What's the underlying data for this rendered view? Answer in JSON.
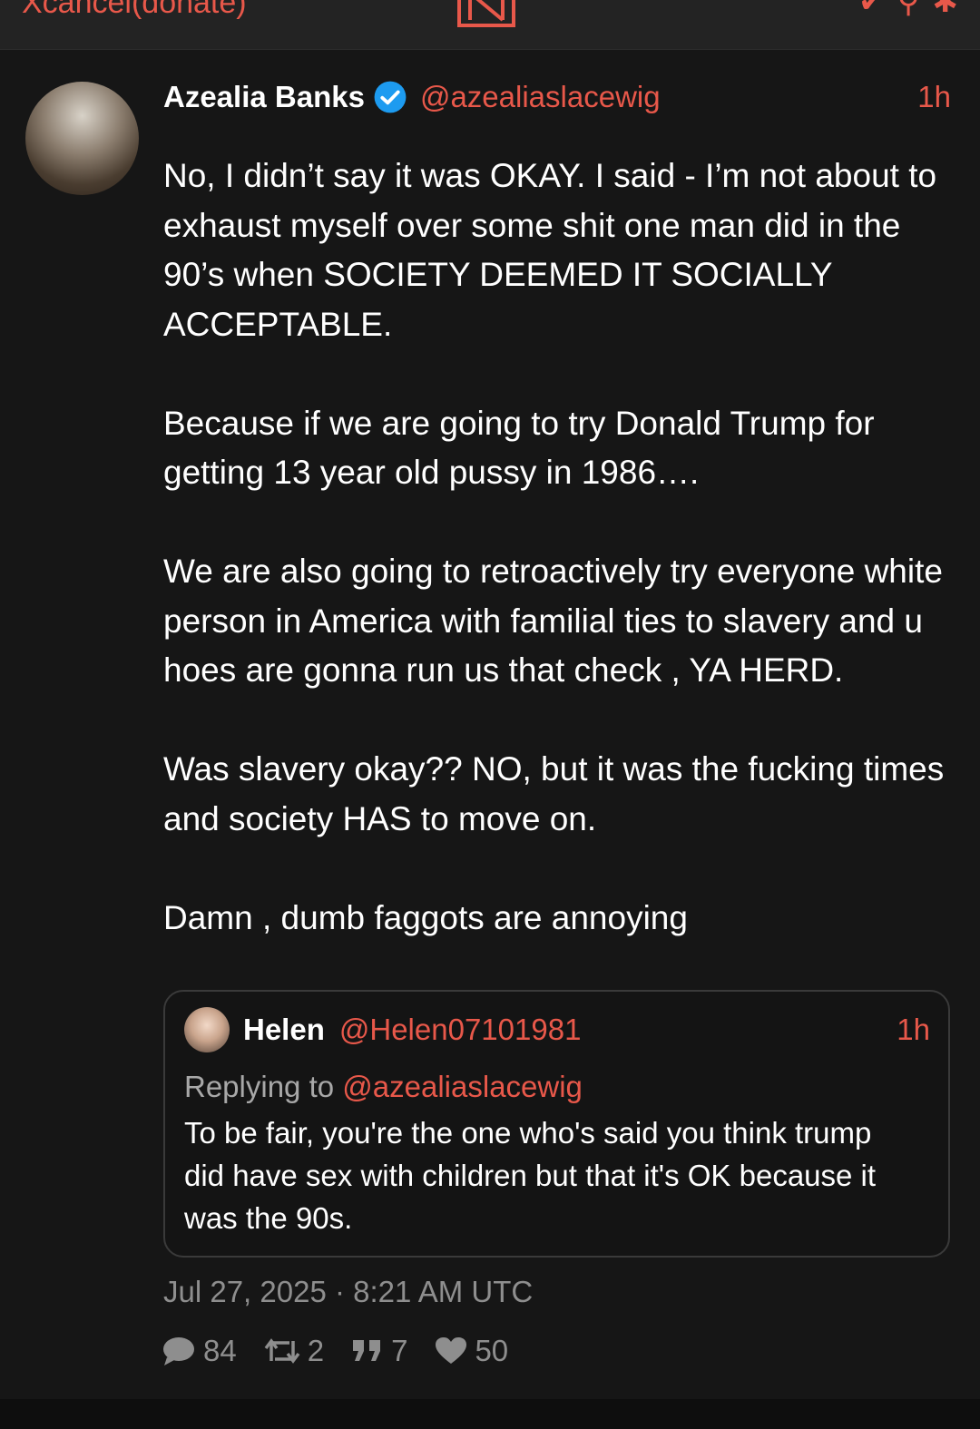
{
  "topbar": {
    "instance": "Xcancel(donate)"
  },
  "tweet": {
    "display_name": "Azealia Banks",
    "handle": "@azealiaslacewig",
    "time": "1h",
    "text": "No, I didn’t say it was OKAY. I said - I’m not about to exhaust myself over some shit one man did in the 90’s when SOCIETY DEEMED IT SOCIALLY ACCEPTABLE.\n\nBecause if we are going to try Donald Trump for getting 13 year old pussy in 1986….\n\nWe are also going to retroactively try everyone white person in America with familial ties to slavery and u hoes are gonna run us that check , YA HERD.\n\nWas slavery okay?? NO, but it was the fucking times and society HAS to move on.\n\nDamn , dumb faggots are annoying",
    "timestamp": "Jul 27, 2025 · 8:21 AM UTC",
    "stats": {
      "replies": "84",
      "retweets": "2",
      "quotes": "7",
      "likes": "50"
    }
  },
  "quote": {
    "display_name": "Helen",
    "handle": "@Helen07101981",
    "time": "1h",
    "replying_prefix": "Replying to",
    "replying_to": "@azealiaslacewig",
    "text": "To be fair, you're the one who's said you think trump did have sex with children but that it's OK because it was the 90s."
  },
  "colors": {
    "accent": "#e8584a",
    "background": "#161616",
    "muted": "#8e8e8e",
    "verified": "#1d9bf0"
  },
  "icons": [
    "logo-icon",
    "verified-icon",
    "reply-icon",
    "retweet-icon",
    "quote-icon",
    "heart-icon"
  ]
}
